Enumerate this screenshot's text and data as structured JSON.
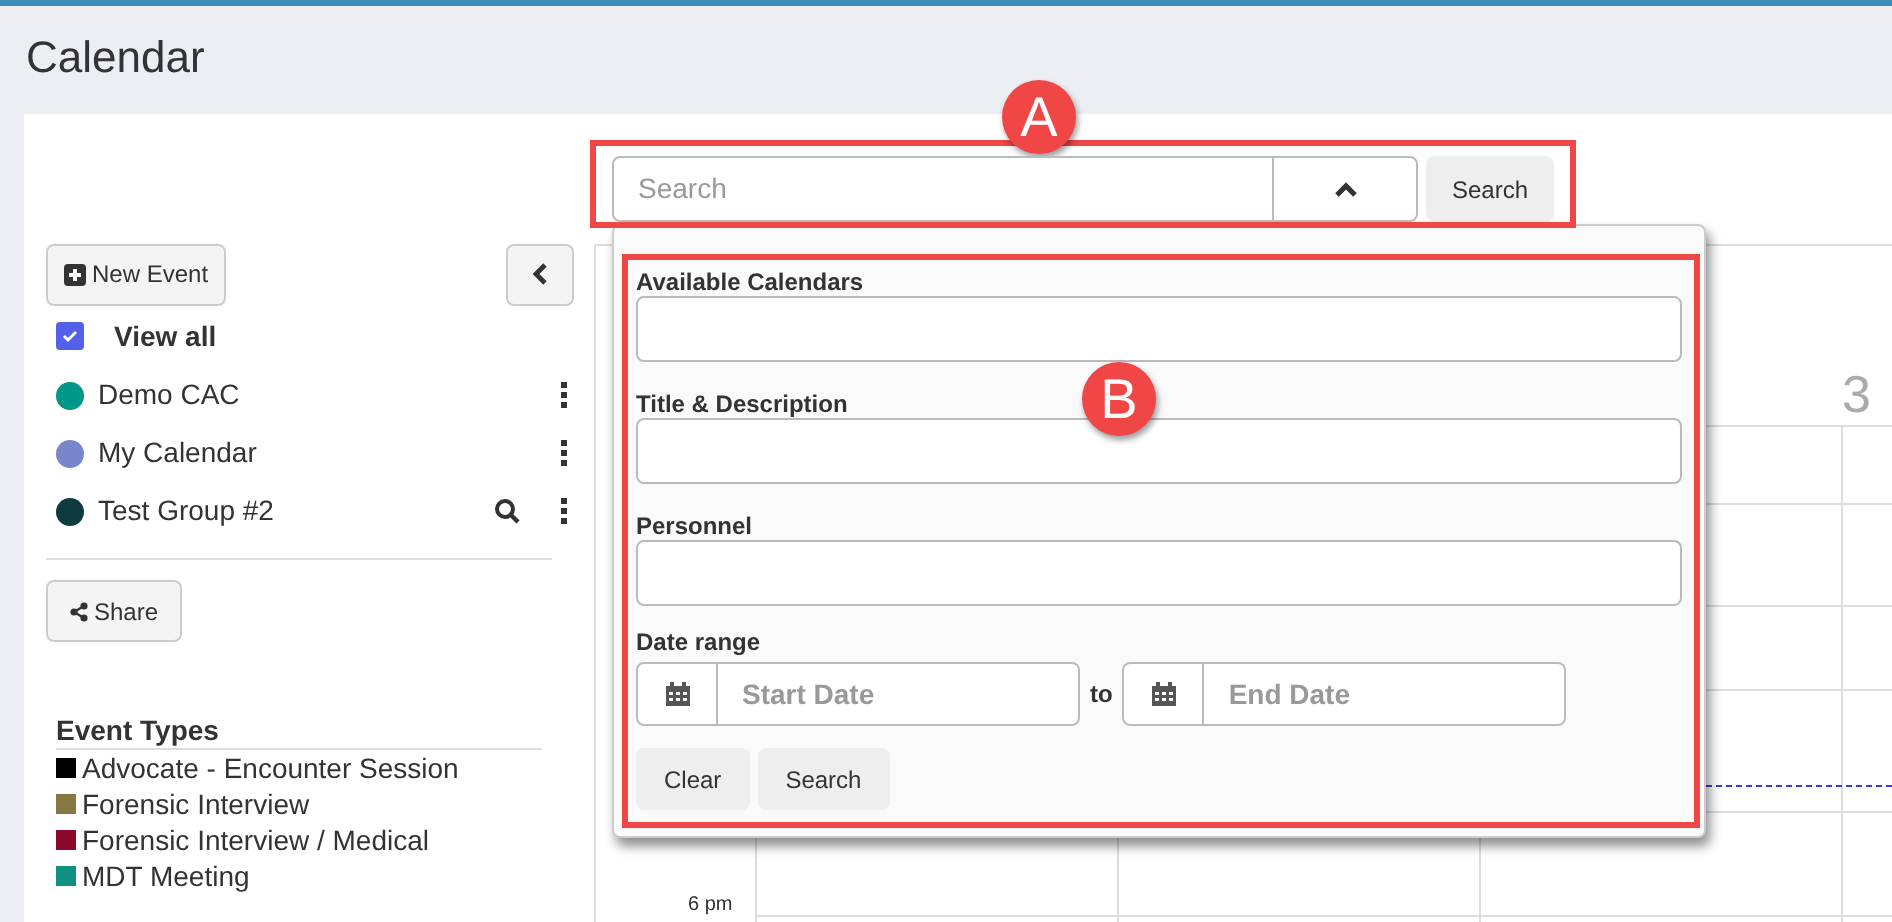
{
  "page": {
    "title": "Calendar"
  },
  "sidebar": {
    "new_event": "New Event",
    "view_all": {
      "label": "View all",
      "checked": true
    },
    "calendars": [
      {
        "name": "Demo CAC",
        "color": "#009688",
        "search": false
      },
      {
        "name": "My Calendar",
        "color": "#7986cb",
        "search": false
      },
      {
        "name": "Test Group #2",
        "color": "#0d3b40",
        "search": true
      }
    ],
    "share": "Share",
    "event_types": {
      "title": "Event Types",
      "items": [
        {
          "label": "Advocate - Encounter Session",
          "color": "#000000"
        },
        {
          "label": "Forensic Interview",
          "color": "#857843"
        },
        {
          "label": "Forensic Interview / Medical",
          "color": "#8b0a2a"
        },
        {
          "label": "MDT Meeting",
          "color": "#0f9080"
        }
      ]
    }
  },
  "calendar": {
    "day_number": "3",
    "time_label": "6 pm"
  },
  "search": {
    "placeholder": "Search",
    "expanded": true,
    "button": "Search"
  },
  "filter": {
    "fields": [
      {
        "label": "Available Calendars"
      },
      {
        "label": "Title & Description"
      },
      {
        "label": "Personnel"
      }
    ],
    "date_range": {
      "label": "Date range",
      "start_placeholder": "Start Date",
      "separator": "to",
      "end_placeholder": "End Date"
    },
    "buttons": [
      "Clear",
      "Search"
    ]
  },
  "annotations": [
    {
      "label": "A"
    },
    {
      "label": "B"
    }
  ]
}
